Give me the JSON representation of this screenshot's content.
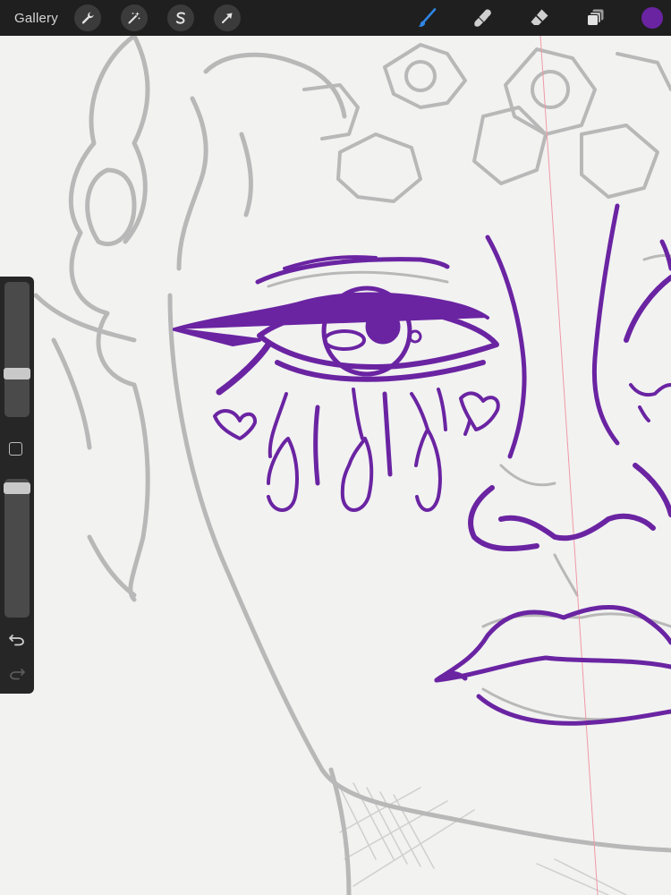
{
  "toolbar": {
    "gallery_label": "Gallery",
    "left_tools": [
      {
        "name": "actions",
        "icon": "wrench-icon"
      },
      {
        "name": "adjustments",
        "icon": "magic-wand-icon"
      },
      {
        "name": "selection",
        "icon": "selection-s-icon"
      },
      {
        "name": "transform",
        "icon": "arrow-cursor-icon"
      }
    ],
    "right_tools": [
      {
        "name": "brush",
        "icon": "brush-icon",
        "active": true,
        "color": "#2f86e6"
      },
      {
        "name": "smudge",
        "icon": "smudge-finger-icon"
      },
      {
        "name": "eraser",
        "icon": "eraser-icon"
      },
      {
        "name": "layers",
        "icon": "layers-icon"
      }
    ],
    "current_color": "#6a24a2"
  },
  "sidebar": {
    "brush_size_level": 0.68,
    "modify_button_icon": "square-icon",
    "opacity_level": 0.98,
    "undo_icon": "undo-icon",
    "redo_icon": "redo-icon",
    "redo_enabled": false
  },
  "canvas": {
    "ink_color": "#6a24a2",
    "sketch_color": "#b9b9b9",
    "guide_line_color": "#f09aa6"
  }
}
